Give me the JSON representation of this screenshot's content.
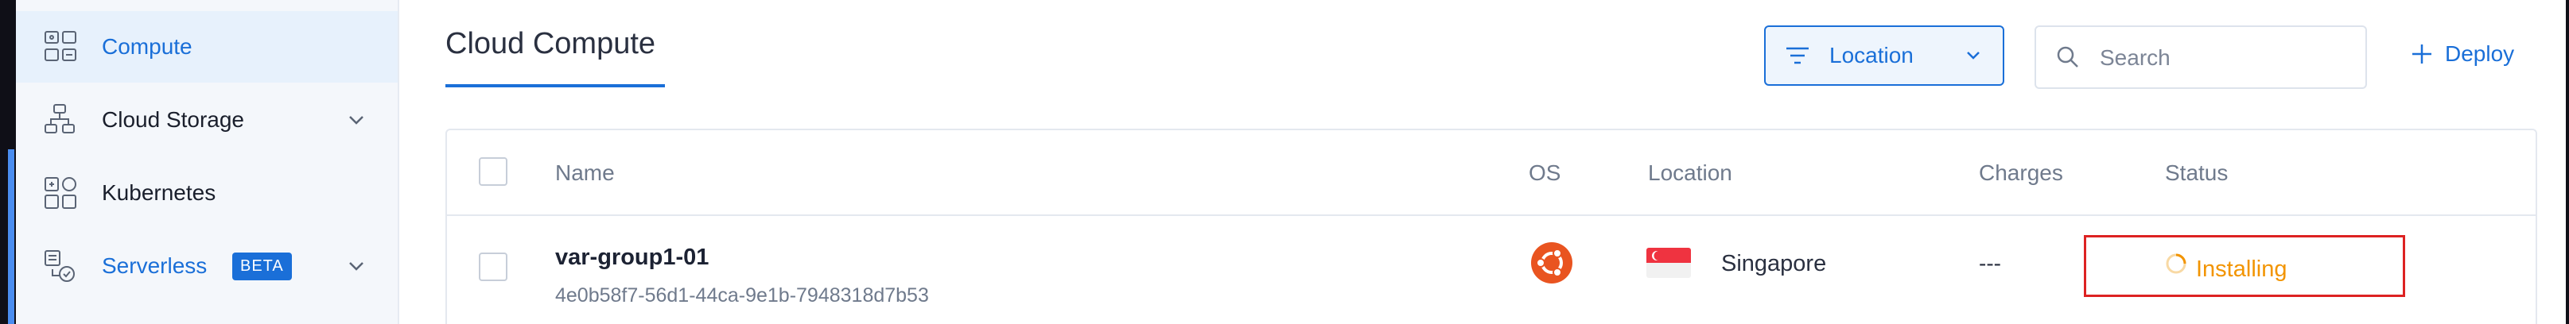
{
  "sidebar": {
    "items": [
      {
        "label": "Compute",
        "icon": "compute-icon"
      },
      {
        "label": "Cloud Storage",
        "icon": "cloud-storage-icon"
      },
      {
        "label": "Kubernetes",
        "icon": "kubernetes-icon"
      },
      {
        "label": "Serverless",
        "icon": "serverless-icon",
        "badge": "BETA"
      }
    ]
  },
  "header": {
    "title": "Cloud Compute",
    "location_filter_label": "Location",
    "search_placeholder": "Search",
    "deploy_label": "Deploy"
  },
  "table": {
    "columns": [
      "Name",
      "OS",
      "Location",
      "Charges",
      "Status"
    ],
    "rows": [
      {
        "name": "var-group1-01",
        "id": "4e0b58f7-56d1-44ca-9e1b-7948318d7b53",
        "os_icon": "ubuntu-icon",
        "location": "Singapore",
        "charges": "---",
        "status": "Installing"
      }
    ]
  },
  "colors": {
    "accent": "#1a6fd8",
    "status_installing": "#f29400",
    "highlight_box": "#dd2222",
    "ubuntu": "#e95420"
  }
}
